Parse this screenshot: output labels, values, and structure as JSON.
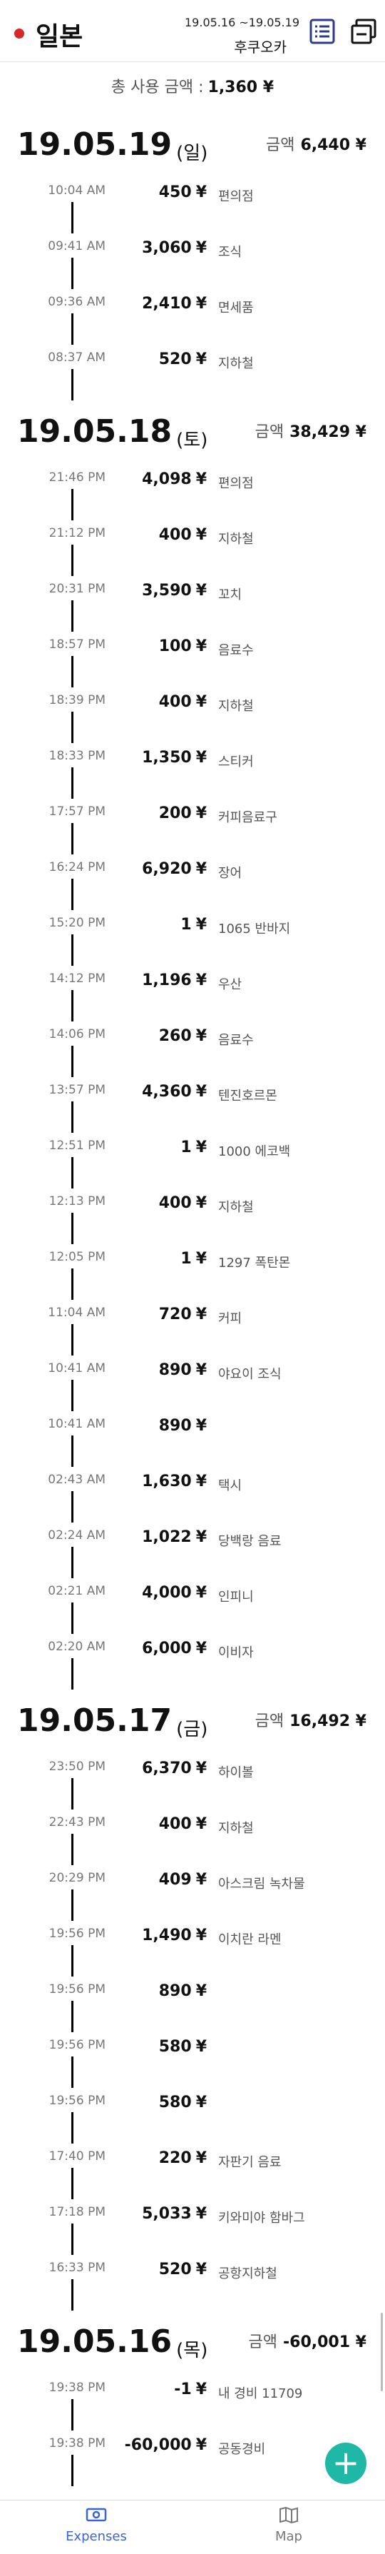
{
  "header": {
    "country": "일본",
    "date_range": "19.05.16 ~19.05.19",
    "city": "후쿠오카"
  },
  "total": {
    "label": "총 사용 금액 :",
    "amount": "1,360 ¥"
  },
  "currency": "¥",
  "days": [
    {
      "date": "19.05.19",
      "dow": "(일)",
      "sum_label": "금액",
      "sum": "6,440 ¥",
      "entries": [
        {
          "time": "10:04 AM",
          "amount": "450",
          "memo": "편의점"
        },
        {
          "time": "09:41 AM",
          "amount": "3,060",
          "memo": "조식"
        },
        {
          "time": "09:36 AM",
          "amount": "2,410",
          "memo": "면세품"
        },
        {
          "time": "08:37 AM",
          "amount": "520",
          "memo": "지하철"
        }
      ]
    },
    {
      "date": "19.05.18",
      "dow": "(토)",
      "sum_label": "금액",
      "sum": "38,429 ¥",
      "entries": [
        {
          "time": "21:46 PM",
          "amount": "4,098",
          "memo": "편의점"
        },
        {
          "time": "21:12 PM",
          "amount": "400",
          "memo": "지하철"
        },
        {
          "time": "20:31 PM",
          "amount": "3,590",
          "memo": "꼬치"
        },
        {
          "time": "18:57 PM",
          "amount": "100",
          "memo": "음료수"
        },
        {
          "time": "18:39 PM",
          "amount": "400",
          "memo": "지하철"
        },
        {
          "time": "18:33 PM",
          "amount": "1,350",
          "memo": "스티커"
        },
        {
          "time": "17:57 PM",
          "amount": "200",
          "memo": "커피음료구"
        },
        {
          "time": "16:24 PM",
          "amount": "6,920",
          "memo": "장어"
        },
        {
          "time": "15:20 PM",
          "amount": "1",
          "memo": "1065 반바지"
        },
        {
          "time": "14:12 PM",
          "amount": "1,196",
          "memo": "우산"
        },
        {
          "time": "14:06 PM",
          "amount": "260",
          "memo": "음료수"
        },
        {
          "time": "13:57 PM",
          "amount": "4,360",
          "memo": "텐진호르몬"
        },
        {
          "time": "12:51 PM",
          "amount": "1",
          "memo": "1000 에코백"
        },
        {
          "time": "12:13 PM",
          "amount": "400",
          "memo": "지하철"
        },
        {
          "time": "12:05 PM",
          "amount": "1",
          "memo": "1297 폭탄몬"
        },
        {
          "time": "11:04 AM",
          "amount": "720",
          "memo": "커피"
        },
        {
          "time": "10:41 AM",
          "amount": "890",
          "memo": "야요이 조식"
        },
        {
          "time": "10:41 AM",
          "amount": "890",
          "memo": ""
        },
        {
          "time": "02:43 AM",
          "amount": "1,630",
          "memo": "택시"
        },
        {
          "time": "02:24 AM",
          "amount": "1,022",
          "memo": "당백랑 음료"
        },
        {
          "time": "02:21 AM",
          "amount": "4,000",
          "memo": "인피니"
        },
        {
          "time": "02:20 AM",
          "amount": "6,000",
          "memo": "이비자"
        }
      ]
    },
    {
      "date": "19.05.17",
      "dow": "(금)",
      "sum_label": "금액",
      "sum": "16,492 ¥",
      "entries": [
        {
          "time": "23:50 PM",
          "amount": "6,370",
          "memo": "하이볼"
        },
        {
          "time": "22:43 PM",
          "amount": "400",
          "memo": "지하철"
        },
        {
          "time": "20:29 PM",
          "amount": "409",
          "memo": "아스크림 녹차물"
        },
        {
          "time": "19:56 PM",
          "amount": "1,490",
          "memo": "이치란 라멘"
        },
        {
          "time": "19:56 PM",
          "amount": "890",
          "memo": ""
        },
        {
          "time": "19:56 PM",
          "amount": "580",
          "memo": ""
        },
        {
          "time": "19:56 PM",
          "amount": "580",
          "memo": ""
        },
        {
          "time": "17:40 PM",
          "amount": "220",
          "memo": "자판기 음료"
        },
        {
          "time": "17:18 PM",
          "amount": "5,033",
          "memo": "키와미야 함바그"
        },
        {
          "time": "16:33 PM",
          "amount": "520",
          "memo": "공항지하철"
        }
      ]
    },
    {
      "date": "19.05.16",
      "dow": "(목)",
      "sum_label": "금액",
      "sum": "-60,001 ¥",
      "entries": [
        {
          "time": "19:38 PM",
          "amount": "-1",
          "memo": "내 경비 11709"
        },
        {
          "time": "19:38 PM",
          "amount": "-60,000",
          "memo": "공동경비"
        }
      ]
    }
  ],
  "fab": {
    "icon": "plus-icon",
    "color": "#1fb8a6"
  },
  "nav": {
    "expenses_label": "Expenses",
    "map_label": "Map",
    "active_color": "#3b63d6"
  }
}
